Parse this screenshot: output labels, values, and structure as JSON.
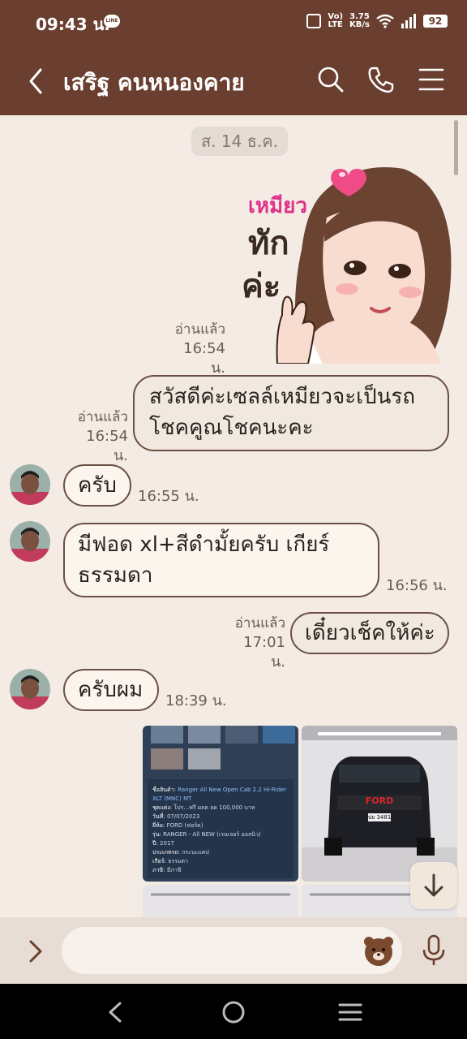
{
  "status_bar": {
    "time": "09:43 น.",
    "line_badge": "LINE",
    "volte": [
      "Vo)",
      "LTE"
    ],
    "speed": [
      "3.75",
      "KB/s"
    ],
    "battery": "92"
  },
  "header": {
    "title": "เสริฐ คนหนองคาย",
    "icons": [
      "back-icon",
      "search-icon",
      "phone-icon",
      "menu-icon"
    ]
  },
  "chat": {
    "date_pill": "ส. 14 ธ.ค.",
    "sticker": {
      "text_top": "เหมียว",
      "text_main_1": "ทัก",
      "text_main_2": "ค่ะ"
    },
    "messages": [
      {
        "id": "m0",
        "sender": "me",
        "type": "sticker",
        "read": "อ่านแล้ว",
        "time": "16:54 น."
      },
      {
        "id": "m1",
        "sender": "me",
        "lines": [
          "สวัสดีค่ะเซลล์เหมียวจะเป็นรถ",
          "โชคคูณโชคนะคะ"
        ],
        "read": "อ่านแล้ว",
        "time": "16:54 น."
      },
      {
        "id": "m2",
        "sender": "them",
        "text": "ครับ",
        "time": "16:55 น."
      },
      {
        "id": "m3",
        "sender": "them",
        "lines": [
          "มีฟอด xl+สีดำมั้ยครับ เกียร์",
          "ธรรมดา"
        ],
        "time": "16:56 น."
      },
      {
        "id": "m4",
        "sender": "me",
        "text": "เดี๋ยวเช็คให้ค่ะ",
        "read": "อ่านแล้ว",
        "time": "17:01 น."
      },
      {
        "id": "m5",
        "sender": "them",
        "text": "ครับผม",
        "time": "18:39 น."
      }
    ],
    "spec_card": {
      "rows": [
        {
          "k": "ชื่อสินค้า:",
          "v": "Ranger All New Open Cab 2.2 Hi-Rider XLT (MNC) MT"
        },
        {
          "k": "ชุดแต่ง:",
          "v": "โปร...ฟรี ผลต ลด 100,000 บาท"
        },
        {
          "k": "วันที่:",
          "v": "07/07/2023"
        },
        {
          "k": "ยี่ห้อ:",
          "v": "FORD (ฟอร์ด)"
        },
        {
          "k": "รุ่น:",
          "v": "RANGER - All NEW (เรนเจอร์ ออลนิว)"
        },
        {
          "k": "ปี:",
          "v": "2017"
        },
        {
          "k": "ประเภทรถ:",
          "v": "กระบะแคป"
        },
        {
          "k": "เกียร์:",
          "v": "ธรรมดา"
        },
        {
          "k": "ภาษี:",
          "v": "มีภาษี"
        }
      ],
      "car_brand": "FORD",
      "plate": "ปย 3481"
    }
  },
  "colors": {
    "header_bg": "#6b3f2f",
    "chat_bg": "#f3ebe4",
    "bubble_border": "#6b4f44",
    "input_bg": "#e8ddd4"
  }
}
